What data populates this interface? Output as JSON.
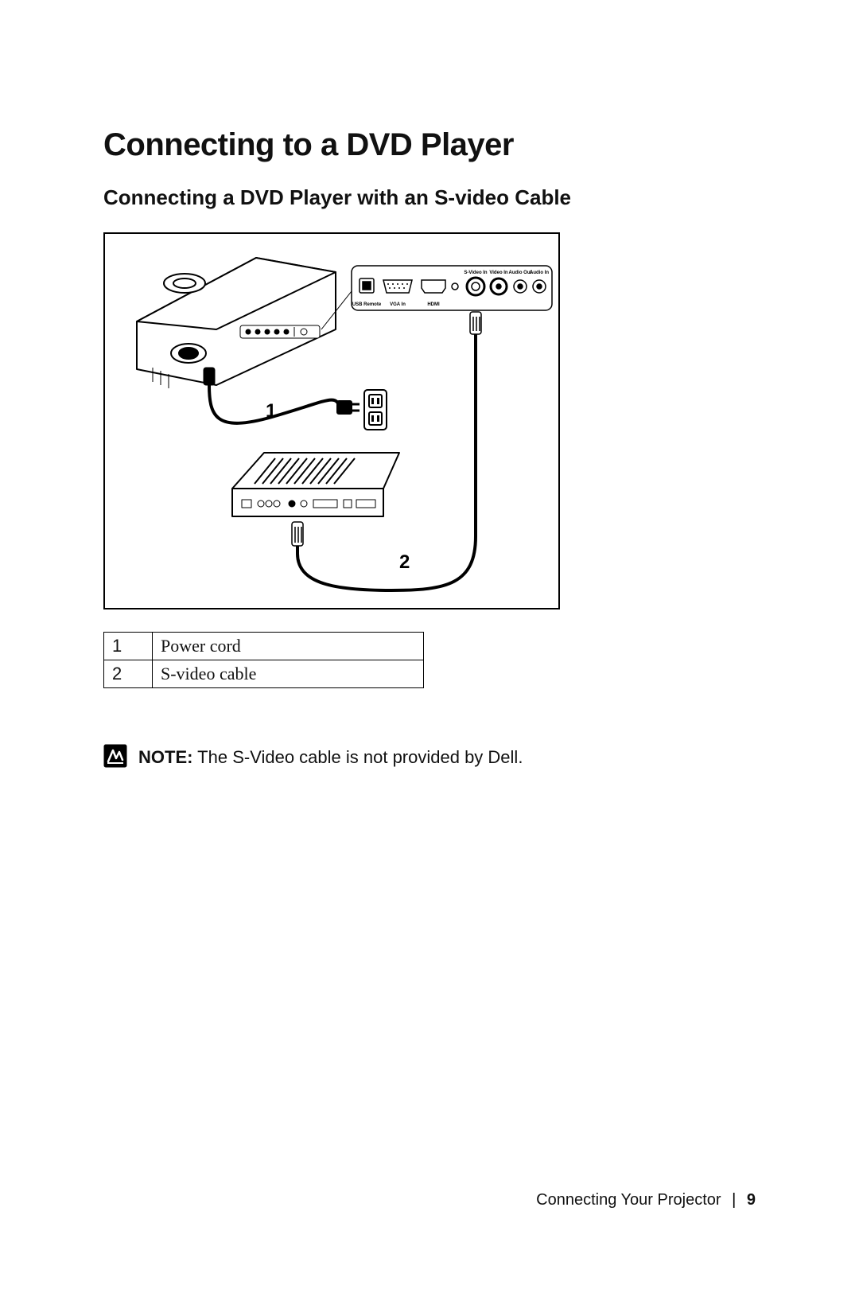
{
  "section_title": "Connecting to a DVD Player",
  "subsection_title": "Connecting a DVD Player with an S-video Cable",
  "diagram": {
    "callouts": {
      "c1": "1",
      "c2": "2"
    },
    "port_labels": {
      "usb": "USB Remote",
      "vga": "VGA In",
      "hdmi": "HDMI",
      "svideo": "S-Video In",
      "video": "Video In",
      "audio_out": "Audio Out",
      "audio_in": "Audio In"
    }
  },
  "legend": [
    {
      "num": "1",
      "desc": "Power cord"
    },
    {
      "num": "2",
      "desc": "S-video cable"
    }
  ],
  "note": {
    "label": "NOTE:",
    "text": " The S-Video cable is not provided by Dell."
  },
  "footer": {
    "chapter": "Connecting Your Projector",
    "page": "9"
  }
}
